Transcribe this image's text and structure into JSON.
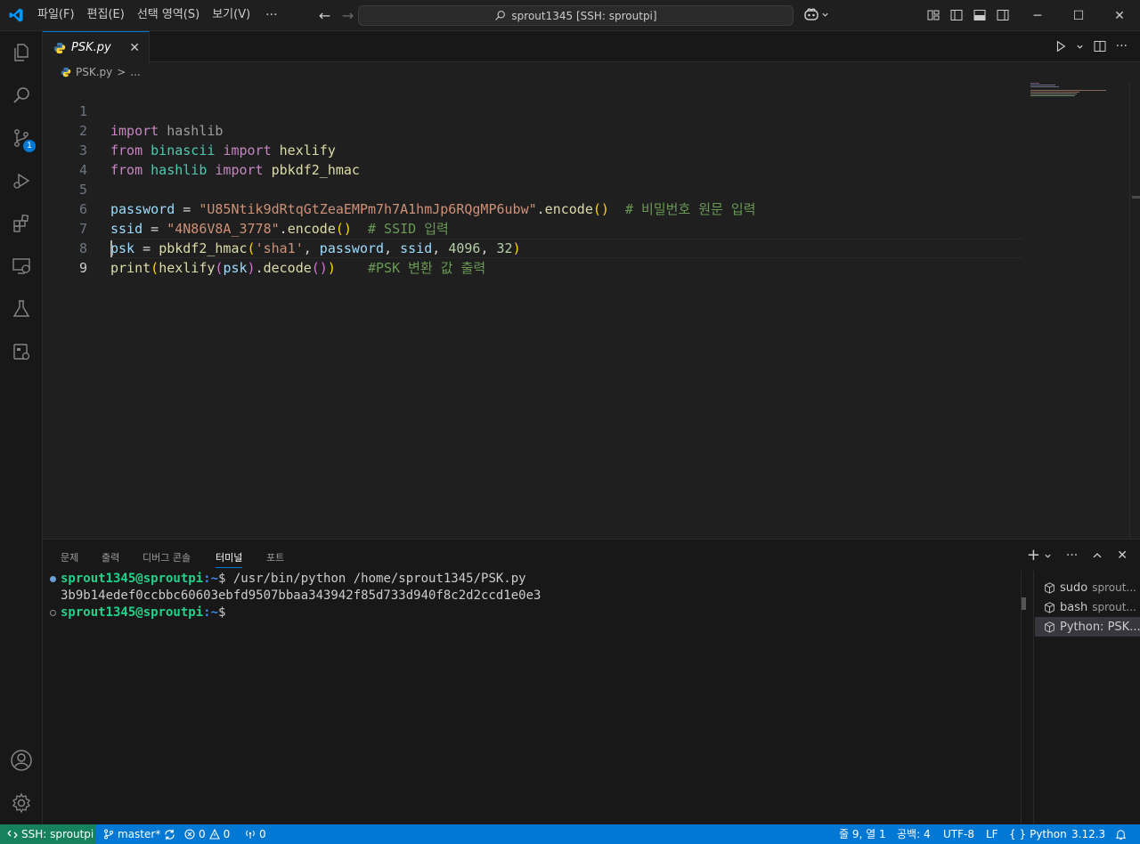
{
  "titlebar": {
    "menu": [
      "파일(F)",
      "편집(E)",
      "선택 영역(S)",
      "보기(V)"
    ],
    "more": "···",
    "search_text": "sprout1345 [SSH: sproutpi]"
  },
  "tabs": {
    "active": {
      "label": "PSK.py",
      "close": "✕"
    }
  },
  "breadcrumb": {
    "file": "PSK.py",
    "sep": ">",
    "rest": "..."
  },
  "editor": {
    "lines": [
      "1",
      "2",
      "3",
      "4",
      "5",
      "6",
      "7",
      "8",
      "9"
    ],
    "password_str": "\"U85Ntik9dRtqGtZeaEMPm7h7A1hmJp6RQgMP6ubw\"",
    "ssid_str": "\"4N86V8A_3778\"",
    "comment_password": "# 비밀번호 원문 입력",
    "comment_ssid": "# SSID 입력",
    "comment_psk": "#PSK 변환 값 출력",
    "hash_name": "'sha1'",
    "iterations": "4096",
    "keylen": "32"
  },
  "panel": {
    "tabs": [
      "문제",
      "출력",
      "디버그 콘솔",
      "터미널",
      "포트"
    ],
    "active_tab": "터미널",
    "terminal": {
      "prompt_user": "sprout1345@sproutpi",
      "prompt_path": ":~",
      "prompt_end": "$ ",
      "command": "/usr/bin/python /home/sprout1345/PSK.py",
      "output": "3b9b14edef0ccbbc60603ebfd9507bbaa343942f85d733d940f8c2d2ccd1e0e3"
    },
    "terminal_list": [
      {
        "name": "sudo",
        "sub": "sprout..."
      },
      {
        "name": "bash",
        "sub": "sprout..."
      },
      {
        "name": "Python: PSK...",
        "sub": ""
      }
    ]
  },
  "statusbar": {
    "remote": "SSH: sproutpi",
    "branch": "master*",
    "errors": "0",
    "warnings": "0",
    "ports": "0",
    "position": "줄 9, 열 1",
    "spaces": "공백: 4",
    "encoding": "UTF-8",
    "eol": "LF",
    "language": "Python",
    "version": "3.12.3"
  },
  "colors": {
    "accent": "#0078d4",
    "remote": "#16825d"
  }
}
